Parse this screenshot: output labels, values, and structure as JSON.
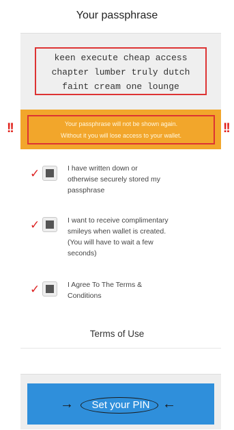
{
  "header": {
    "title": "Your passphrase"
  },
  "passphrase": {
    "lines": [
      "keen execute cheap access",
      "chapter lumber truly dutch",
      "faint cream one lounge"
    ]
  },
  "warning": {
    "lines": [
      "Your passphrase will not be shown again.",
      "Without it you will lose access to your wallet."
    ],
    "marker": "!!"
  },
  "options": [
    {
      "lines": [
        "I have written down or",
        "otherwise securely stored my",
        "passphrase"
      ],
      "checked": true
    },
    {
      "lines": [
        "I want to receive complimentary",
        "smileys when wallet is created.",
        "(You will have to wait a few",
        "seconds)"
      ],
      "checked": true
    },
    {
      "lines": [
        "I Agree To The Terms &",
        "Conditions"
      ],
      "checked": true
    }
  ],
  "annotations": {
    "check_mark": "✓",
    "arrow_right": "→",
    "arrow_left": "←"
  },
  "terms_link": "Terms of Use",
  "pin_button": {
    "label": "Set your PIN"
  },
  "colors": {
    "button": "#2f8fdb",
    "warning": "#f2a62b",
    "highlight": "#dd3333"
  }
}
